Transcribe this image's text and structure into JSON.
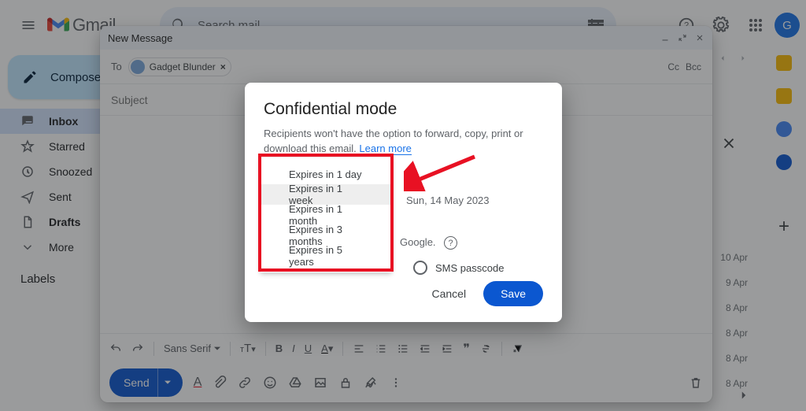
{
  "header": {
    "logo_text": "Gmail",
    "search_placeholder": "Search mail",
    "avatar_initial": "G"
  },
  "sidebar": {
    "compose": "Compose",
    "items": [
      {
        "label": "Inbox"
      },
      {
        "label": "Starred"
      },
      {
        "label": "Snoozed"
      },
      {
        "label": "Sent"
      },
      {
        "label": "Drafts"
      },
      {
        "label": "More"
      }
    ],
    "labels_header": "Labels"
  },
  "compose_window": {
    "title": "New Message",
    "to_label": "To",
    "recipient": "Gadget Blunder",
    "cc": "Cc",
    "bcc": "Bcc",
    "subject_placeholder": "Subject",
    "font_family": "Sans Serif",
    "send": "Send"
  },
  "modal": {
    "title": "Confidential mode",
    "description": "Recipients won't have the option to forward, copy, print or download this email. ",
    "learn_more": "Learn more",
    "expire_date": "Sun, 14 May 2023",
    "google_label": "Google.",
    "sms_label": "SMS passcode",
    "cancel": "Cancel",
    "save": "Save",
    "options": [
      "Expires in 1 day",
      "Expires in 1 week",
      "Expires in 1 month",
      "Expires in 3 months",
      "Expires in 5 years"
    ]
  },
  "dates": [
    "10 Apr",
    "9 Apr",
    "8 Apr",
    "8 Apr",
    "8 Apr",
    "8 Apr"
  ]
}
